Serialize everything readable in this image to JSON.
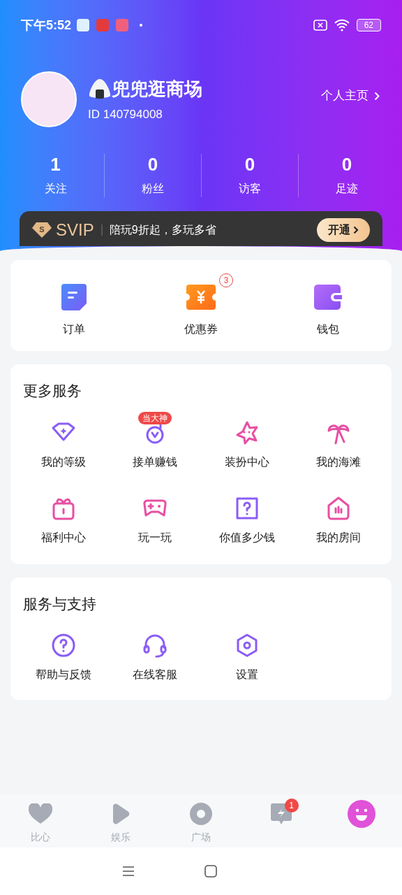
{
  "status_bar": {
    "time": "下午5:52",
    "battery": "62"
  },
  "profile": {
    "name": "兜兜逛商场",
    "id": "ID 140794008",
    "homepage_link": "个人主页"
  },
  "stats": [
    {
      "value": "1",
      "label": "关注"
    },
    {
      "value": "0",
      "label": "粉丝"
    },
    {
      "value": "0",
      "label": "访客"
    },
    {
      "value": "0",
      "label": "足迹"
    }
  ],
  "svip": {
    "emblem_letter": "S",
    "brand": "SVIP",
    "text": "陪玩9折起，多玩多省",
    "button": "开通"
  },
  "quick_actions": [
    {
      "kind": "order",
      "label": "订单"
    },
    {
      "kind": "coupon",
      "label": "优惠券",
      "badge": "3"
    },
    {
      "kind": "wallet",
      "label": "钱包"
    }
  ],
  "more_services": {
    "title": "更多服务",
    "items": [
      {
        "kind": "level",
        "label": "我的等级"
      },
      {
        "kind": "earn",
        "label": "接单赚钱",
        "badge": "当大神"
      },
      {
        "kind": "dressup",
        "label": "装扮中心"
      },
      {
        "kind": "beach",
        "label": "我的海滩"
      },
      {
        "kind": "gift",
        "label": "福利中心"
      },
      {
        "kind": "game",
        "label": "玩一玩"
      },
      {
        "kind": "question",
        "label": "你值多少钱"
      },
      {
        "kind": "room",
        "label": "我的房间"
      }
    ]
  },
  "support": {
    "title": "服务与支持",
    "items": [
      {
        "kind": "help",
        "label": "帮助与反馈"
      },
      {
        "kind": "service",
        "label": "在线客服"
      },
      {
        "kind": "settings",
        "label": "设置"
      }
    ]
  },
  "bottom_nav": [
    {
      "kind": "heart",
      "label": "比心",
      "selected": false
    },
    {
      "kind": "play",
      "label": "娱乐",
      "selected": false
    },
    {
      "kind": "plaza",
      "label": "广场",
      "selected": false
    },
    {
      "kind": "message",
      "selected": false,
      "badge": "1"
    },
    {
      "kind": "me",
      "selected": true
    }
  ]
}
